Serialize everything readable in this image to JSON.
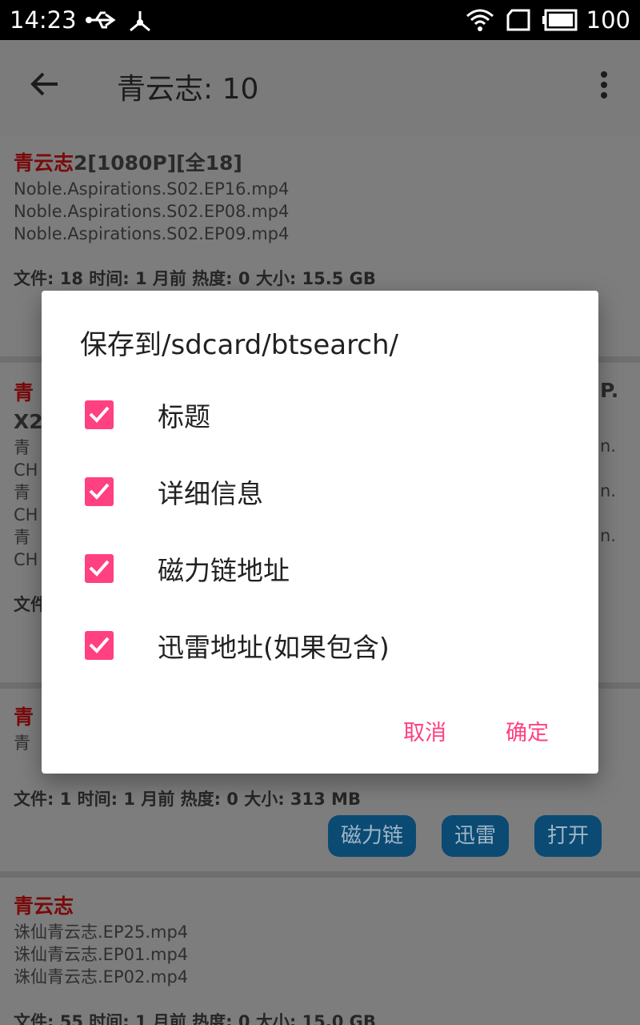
{
  "status_bar": {
    "time": "14:23",
    "battery": "100",
    "icons": [
      "usb-icon",
      "debug-icon",
      "wifi-icon",
      "sim-icon",
      "battery-icon"
    ]
  },
  "app_bar": {
    "title": "青云志: 10",
    "icons": [
      "back-arrow-icon",
      "more-vert-icon"
    ]
  },
  "results": [
    {
      "title_highlight": "青云志",
      "title_rest": "2[1080P][全18]",
      "files": [
        "Noble.Aspirations.S02.EP16.mp4",
        "Noble.Aspirations.S02.EP08.mp4",
        "Noble.Aspirations.S02.EP09.mp4"
      ],
      "meta": "文件: 18  时间: 1 月前   热度: 0   大小: 15.5 GB"
    },
    {
      "title_highlight": "青",
      "title_rest": "",
      "title_line2": "X2",
      "title_tail": "P.",
      "files": [
        "青",
        "CH",
        "青",
        "CH",
        "青",
        "CH"
      ],
      "file_tails": [
        "n.",
        "n.",
        "n."
      ],
      "meta": "文件"
    },
    {
      "title_highlight": "青",
      "title_rest": "",
      "files": [
        "青"
      ],
      "meta": "文件: 1  时间: 1 月前   热度: 0   大小: 313 MB",
      "buttons": [
        "磁力链",
        "迅雷",
        "打开"
      ]
    },
    {
      "title_highlight": "青云志",
      "title_rest": "",
      "files": [
        "诛仙青云志.EP25.mp4",
        "诛仙青云志.EP01.mp4",
        "诛仙青云志.EP02.mp4"
      ],
      "meta": "文件: 55  时间: 1 月前   热度: 0   大小: 15.0 GB"
    }
  ],
  "dialog": {
    "title": "保存到/sdcard/btsearch/",
    "options": [
      {
        "label": "标题",
        "checked": true
      },
      {
        "label": "详细信息",
        "checked": true
      },
      {
        "label": "磁力链地址",
        "checked": true
      },
      {
        "label": "迅雷地址(如果包含)",
        "checked": true
      }
    ],
    "cancel": "取消",
    "confirm": "确定",
    "accent_color": "#ff4081"
  }
}
